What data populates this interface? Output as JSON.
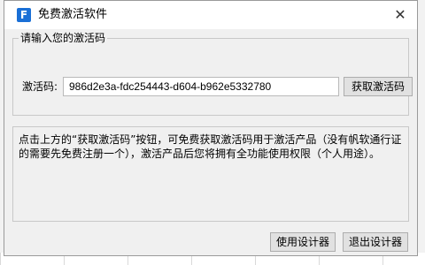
{
  "window": {
    "title": "免费激活软件",
    "icon": "app-logo-icon",
    "close_glyph": "✕"
  },
  "group": {
    "title": "请输入您的激活码",
    "code_label": "激活码:",
    "code_value": "986d2e3a-fdc254443-d604-b962e5332780",
    "get_button_label": "获取激活码"
  },
  "info": {
    "text": "点击上方的“获取激活码”按钮，可免费获取激活码用于激活产品（没有帆软通行证的需要先免费注册一个），激活产品后您将拥有全功能使用权限（个人用途）。"
  },
  "footer": {
    "use_button_label": "使用设计器",
    "exit_button_label": "退出设计器"
  }
}
